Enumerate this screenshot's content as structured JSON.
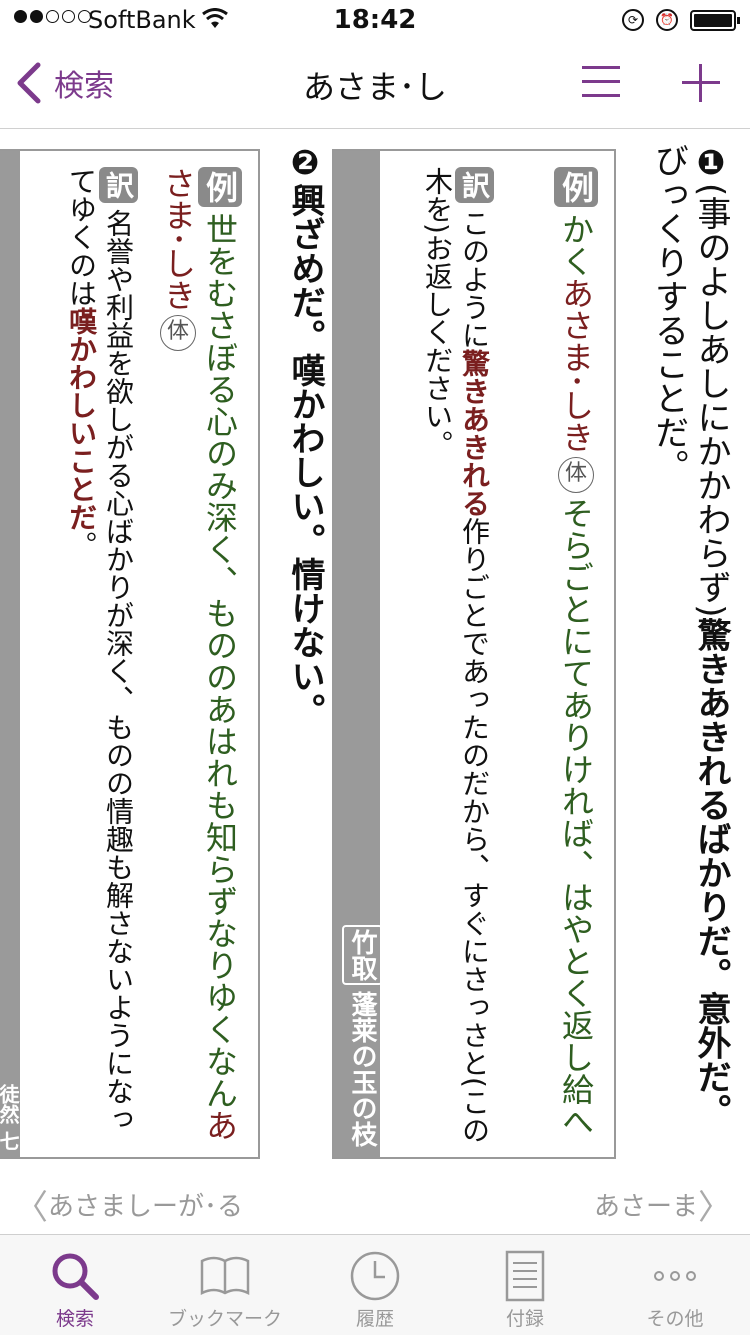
{
  "status_bar": {
    "carrier": "SoftBank",
    "time": "18:42"
  },
  "nav": {
    "back_label": "検索",
    "title": "あさま･し"
  },
  "entry": {
    "sense1": {
      "number": "❶",
      "definition_prefix": "(事のよしあしにかかわらず)",
      "definition_bold": "驚きあきれるばかりだ。意外だ。",
      "definition_rest": "びっくりすることだ。",
      "example_tag": "例",
      "example_a": "かく",
      "example_head": "あさま･しき",
      "example_form": "体",
      "example_b": "そらごとにてありければ、はやとく返し給へ",
      "translation_tag": "訳",
      "translation_a": "このように",
      "translation_bold": "驚きあきれる",
      "translation_b": "作りごとであったのだから、すぐにさっさと(この木を)お返しください。",
      "source_work": "竹取",
      "source_chapter": "蓬莱の玉の枝"
    },
    "sense2": {
      "number": "❷",
      "definition_bold": "興ざめだ。嘆かわしい。情けない。",
      "example_tag": "例",
      "example_a": "世をむさぼる心のみ深く、もののあはれも知らずなりゆくなん",
      "example_head": "あさま･しき",
      "example_form": "体",
      "translation_tag": "訳",
      "translation_a": "名誉や利益を欲しがる心ばかりが深く、ものの情趣も解さないようになってゆくのは",
      "translation_bold": "嘆かわしいことだ",
      "translation_end": "。",
      "source_partial": "徒然 七"
    }
  },
  "pager": {
    "prev": "あさましーが･る",
    "next": "あさーま"
  },
  "tabs": [
    {
      "label": "検索",
      "icon": "search-icon",
      "active": true
    },
    {
      "label": "ブックマーク",
      "icon": "book-icon",
      "active": false
    },
    {
      "label": "履歴",
      "icon": "clock-icon",
      "active": false
    },
    {
      "label": "付録",
      "icon": "document-icon",
      "active": false
    },
    {
      "label": "その他",
      "icon": "more-icon",
      "active": false
    }
  ],
  "colors": {
    "accent": "#7c3a8c",
    "headword_red": "#7a1f1f",
    "example_green": "#2e5e20",
    "tag_gray": "#8a8a8a"
  }
}
